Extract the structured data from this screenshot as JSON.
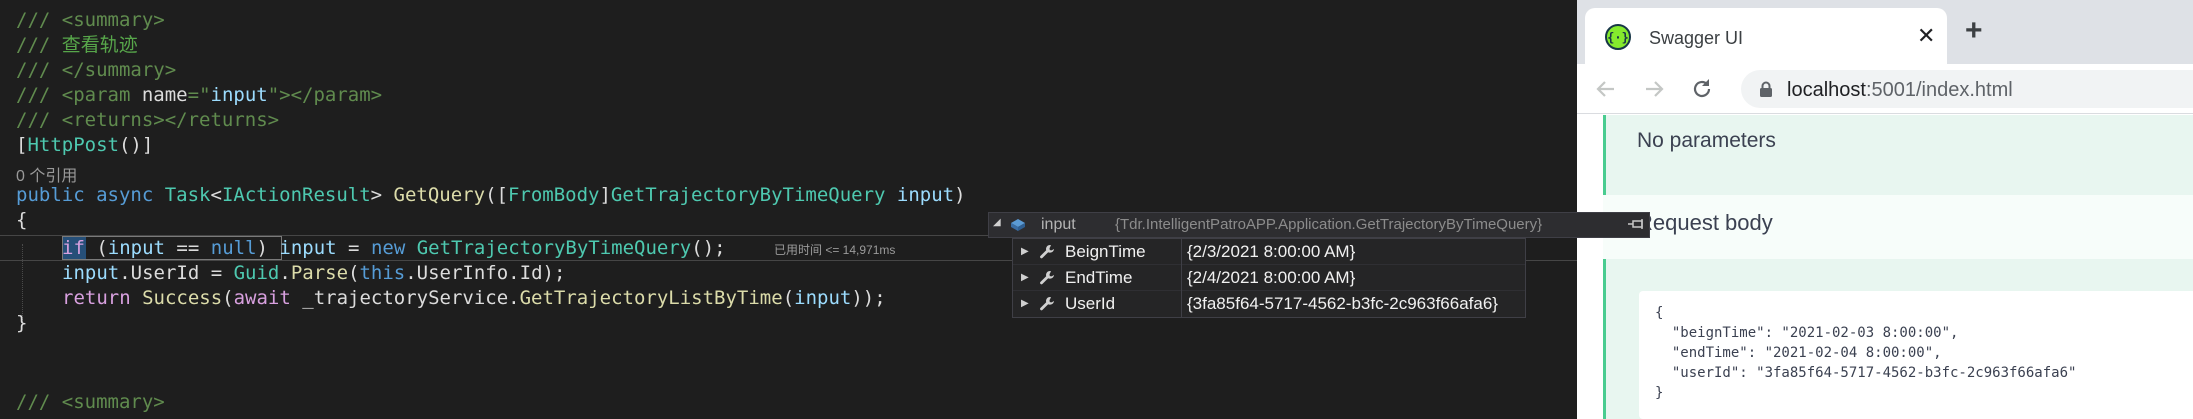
{
  "editor": {
    "lines": {
      "l1": {
        "slashes": "///",
        "tag": " <summary>"
      },
      "l2": {
        "slashes": "///",
        "text": " 查看轨迹"
      },
      "l3": {
        "slashes": "///",
        "tag": " </summary>"
      },
      "l4": {
        "slashes": "///",
        "tag_open": " <param",
        "attr": " name",
        "eq": "=",
        "quote_open": "\"",
        "attr_val": "input",
        "quote_close": "\"",
        "tag_close": "></param>"
      },
      "l5": {
        "slashes": "///",
        "tag": " <returns></returns>"
      },
      "l6": {
        "open": "[",
        "attr": "HttpPost",
        "parens": "()",
        "close": "]"
      },
      "codelens": "0 个引用",
      "l7": {
        "kw_public": "public",
        "kw_async": " async",
        "type_task": " Task",
        "lt": "<",
        "type_iar": "IActionResult",
        "gt": ">",
        "method": " GetQuery",
        "p1": "([",
        "attr_frombody": "FromBody",
        "p2": "]",
        "type_query": "GetTrajectoryByTimeQuery",
        "param": " input",
        "p3": ")"
      },
      "l8": "{",
      "l9": {
        "kw_if": "if",
        "cond_open": " (",
        "var_input": "input",
        "cond_op": " == ",
        "kw_null": "null",
        "cond_close": ")",
        "var_input2": " input",
        "assign": " = ",
        "kw_new": "new",
        "type": " GetTrajectoryByTimeQuery",
        "end": "();"
      },
      "elapsed": "已用时间 <= 14,971ms",
      "l10": {
        "var": "input",
        "prop": ".UserId = ",
        "type": "Guid",
        "dot": ".",
        "method": "Parse",
        "p1": "(",
        "kw_this": "this",
        "rest": ".UserInfo.Id);"
      },
      "l11": {
        "kw_return": "return",
        "method": " Success",
        "p1": "(",
        "kw_await": "await",
        "rest1": " _trajectoryService.",
        "method2": "GetTrajectoryListByTime",
        "p2": "(",
        "var": "input",
        "p3": "));"
      },
      "l12": "}",
      "l13": {
        "slashes": "///",
        "tag": " <summary>"
      }
    }
  },
  "datatip": {
    "name": "input",
    "value": "{Tdr.IntelligentPatroAPP.Application.GetTrajectoryByTimeQuery}",
    "rows": [
      {
        "name": "BeignTime",
        "value": "{2/3/2021 8:00:00 AM}"
      },
      {
        "name": "EndTime",
        "value": "{2/4/2021 8:00:00 AM}"
      },
      {
        "name": "UserId",
        "value": "{3fa85f64-5717-4562-b3fc-2c963f66afa6}"
      }
    ]
  },
  "browser": {
    "tab_title": "Swagger UI",
    "close_glyph": "✕",
    "newtab_glyph": "+",
    "url_host": "localhost",
    "url_rest": ":5001/index.html",
    "no_parameters": "No parameters",
    "request_body": "Request body",
    "json": [
      "{",
      "  \"beignTime\": \"2021-02-03 8:00:00\",",
      "  \"endTime\": \"2021-02-04 8:00:00\",",
      "  \"userId\": \"3fa85f64-5717-4562-b3fc-2c963f66afa6\"",
      "}"
    ]
  },
  "colors": {
    "editor_bg": "#1e1e1e",
    "comment": "#57a64a",
    "keyword": "#569cd6",
    "type": "#4ec9b0",
    "method": "#dcdcaa",
    "swagger_green": "#49cc90"
  }
}
